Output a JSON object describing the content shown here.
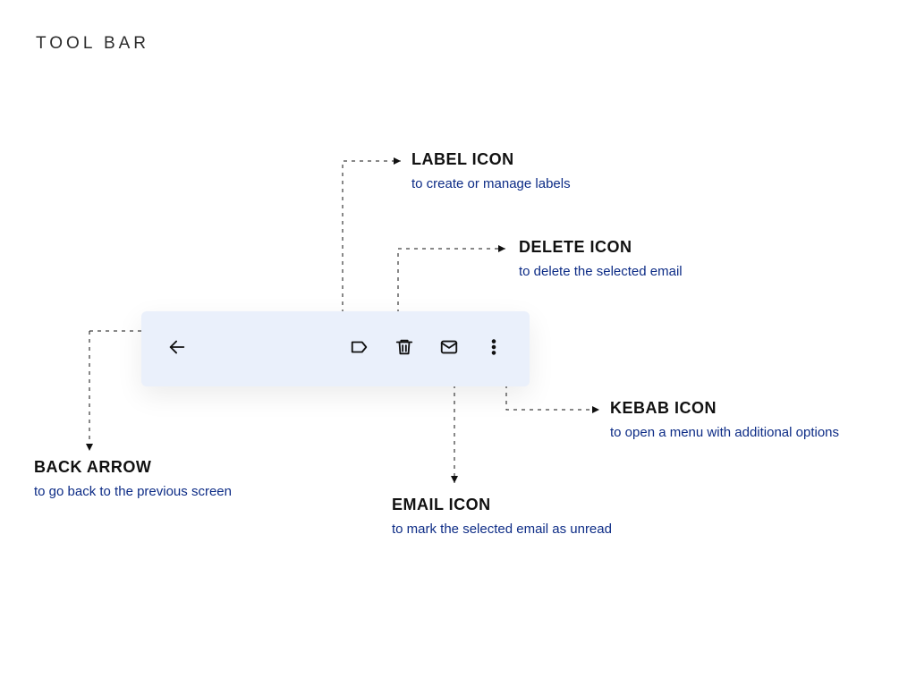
{
  "page": {
    "title": "TOOL BAR"
  },
  "toolbar": {
    "icons": {
      "back": "back-arrow-icon",
      "label": "label-icon",
      "delete": "delete-icon",
      "email": "email-icon",
      "kebab": "kebab-icon"
    }
  },
  "annotations": {
    "label": {
      "title": "LABEL ICON",
      "desc": "to create or manage labels"
    },
    "delete": {
      "title": "DELETE ICON",
      "desc": "to delete the selected email"
    },
    "kebab": {
      "title": "KEBAB ICON",
      "desc": "to open a menu with additional options"
    },
    "email": {
      "title": "EMAIL ICON",
      "desc": "to mark the selected email as unread"
    },
    "back": {
      "title": "BACK ARROW",
      "desc": "to go back to the previous screen"
    }
  }
}
